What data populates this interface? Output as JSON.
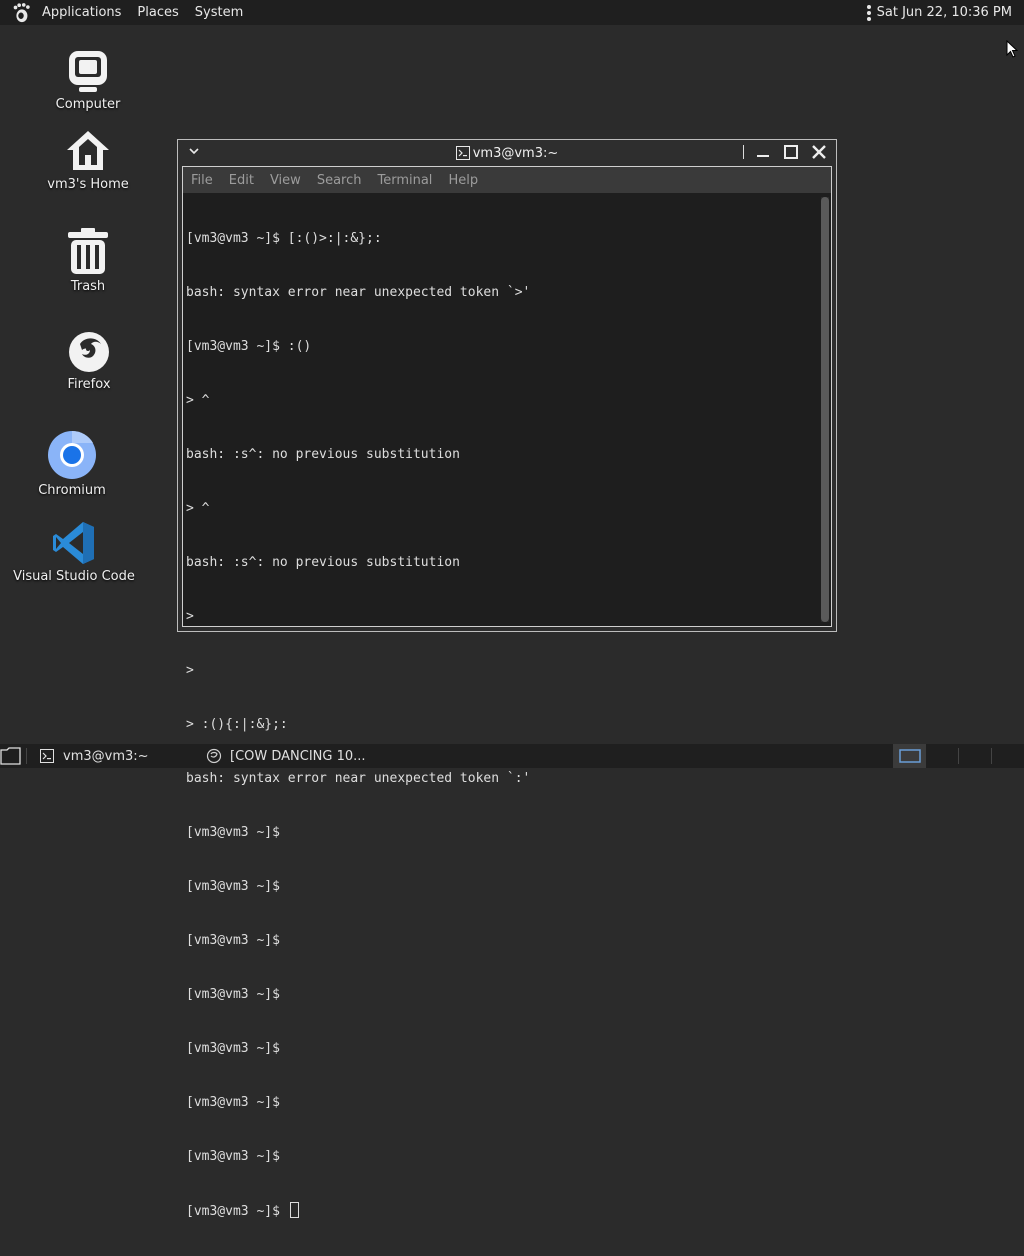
{
  "top_panel": {
    "menus": [
      "Applications",
      "Places",
      "System"
    ],
    "clock": "Sat Jun 22, 10:36 PM"
  },
  "desktop": {
    "icons": [
      {
        "label": "Computer",
        "icon": "computer-icon"
      },
      {
        "label": "vm3's Home",
        "icon": "home-folder-icon"
      },
      {
        "label": "Trash",
        "icon": "trash-icon"
      },
      {
        "label": "Firefox",
        "icon": "firefox-icon"
      },
      {
        "label": "Chromium",
        "icon": "chromium-icon"
      },
      {
        "label": "Visual Studio Code",
        "icon": "vscode-icon"
      }
    ]
  },
  "terminal": {
    "title": "vm3@vm3:~",
    "menu": [
      "File",
      "Edit",
      "View",
      "Search",
      "Terminal",
      "Help"
    ],
    "lines": [
      "[vm3@vm3 ~]$ [:()>:|:&};:",
      "bash: syntax error near unexpected token `>'",
      "[vm3@vm3 ~]$ :()",
      "> ^",
      "bash: :s^: no previous substitution",
      "> ^",
      "bash: :s^: no previous substitution",
      ">",
      ">",
      "> :(){:|:&};:",
      "bash: syntax error near unexpected token `:'",
      "[vm3@vm3 ~]$",
      "[vm3@vm3 ~]$",
      "[vm3@vm3 ~]$",
      "[vm3@vm3 ~]$",
      "[vm3@vm3 ~]$",
      "[vm3@vm3 ~]$",
      "[vm3@vm3 ~]$",
      "[vm3@vm3 ~]$"
    ],
    "prompt": "[vm3@vm3 ~]$ "
  },
  "taskbar": {
    "tasks": [
      {
        "label": "vm3@vm3:~",
        "icon": "terminal-icon"
      },
      {
        "label": "[COW DANCING 10...",
        "icon": "cow-icon"
      }
    ]
  },
  "colors": {
    "desktop_bg": "#2b2b2b",
    "panel_bg": "#1f1f1f",
    "terminal_bg": "#1e1e1e",
    "chromium_blue": "#1a73e8",
    "vscode_blue": "#2a8bd8"
  }
}
